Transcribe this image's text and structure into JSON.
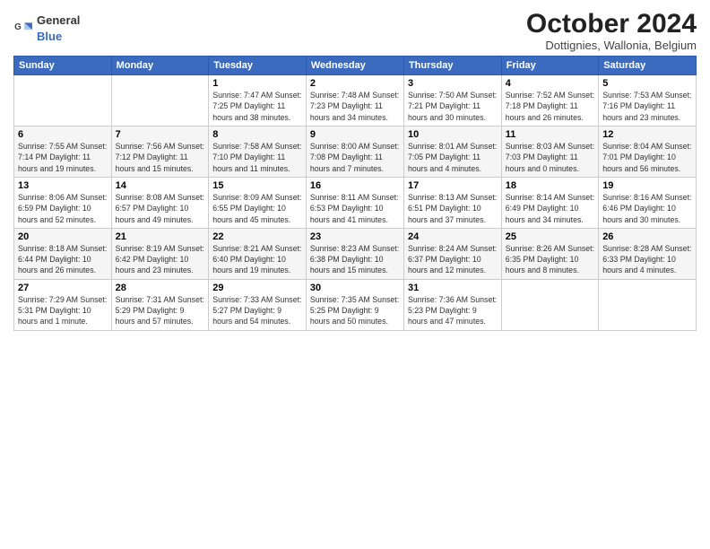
{
  "header": {
    "logo_general": "General",
    "logo_blue": "Blue",
    "month_title": "October 2024",
    "location": "Dottignies, Wallonia, Belgium"
  },
  "days_of_week": [
    "Sunday",
    "Monday",
    "Tuesday",
    "Wednesday",
    "Thursday",
    "Friday",
    "Saturday"
  ],
  "weeks": [
    [
      {
        "day": "",
        "info": ""
      },
      {
        "day": "",
        "info": ""
      },
      {
        "day": "1",
        "info": "Sunrise: 7:47 AM\nSunset: 7:25 PM\nDaylight: 11 hours and 38 minutes."
      },
      {
        "day": "2",
        "info": "Sunrise: 7:48 AM\nSunset: 7:23 PM\nDaylight: 11 hours and 34 minutes."
      },
      {
        "day": "3",
        "info": "Sunrise: 7:50 AM\nSunset: 7:21 PM\nDaylight: 11 hours and 30 minutes."
      },
      {
        "day": "4",
        "info": "Sunrise: 7:52 AM\nSunset: 7:18 PM\nDaylight: 11 hours and 26 minutes."
      },
      {
        "day": "5",
        "info": "Sunrise: 7:53 AM\nSunset: 7:16 PM\nDaylight: 11 hours and 23 minutes."
      }
    ],
    [
      {
        "day": "6",
        "info": "Sunrise: 7:55 AM\nSunset: 7:14 PM\nDaylight: 11 hours and 19 minutes."
      },
      {
        "day": "7",
        "info": "Sunrise: 7:56 AM\nSunset: 7:12 PM\nDaylight: 11 hours and 15 minutes."
      },
      {
        "day": "8",
        "info": "Sunrise: 7:58 AM\nSunset: 7:10 PM\nDaylight: 11 hours and 11 minutes."
      },
      {
        "day": "9",
        "info": "Sunrise: 8:00 AM\nSunset: 7:08 PM\nDaylight: 11 hours and 7 minutes."
      },
      {
        "day": "10",
        "info": "Sunrise: 8:01 AM\nSunset: 7:05 PM\nDaylight: 11 hours and 4 minutes."
      },
      {
        "day": "11",
        "info": "Sunrise: 8:03 AM\nSunset: 7:03 PM\nDaylight: 11 hours and 0 minutes."
      },
      {
        "day": "12",
        "info": "Sunrise: 8:04 AM\nSunset: 7:01 PM\nDaylight: 10 hours and 56 minutes."
      }
    ],
    [
      {
        "day": "13",
        "info": "Sunrise: 8:06 AM\nSunset: 6:59 PM\nDaylight: 10 hours and 52 minutes."
      },
      {
        "day": "14",
        "info": "Sunrise: 8:08 AM\nSunset: 6:57 PM\nDaylight: 10 hours and 49 minutes."
      },
      {
        "day": "15",
        "info": "Sunrise: 8:09 AM\nSunset: 6:55 PM\nDaylight: 10 hours and 45 minutes."
      },
      {
        "day": "16",
        "info": "Sunrise: 8:11 AM\nSunset: 6:53 PM\nDaylight: 10 hours and 41 minutes."
      },
      {
        "day": "17",
        "info": "Sunrise: 8:13 AM\nSunset: 6:51 PM\nDaylight: 10 hours and 37 minutes."
      },
      {
        "day": "18",
        "info": "Sunrise: 8:14 AM\nSunset: 6:49 PM\nDaylight: 10 hours and 34 minutes."
      },
      {
        "day": "19",
        "info": "Sunrise: 8:16 AM\nSunset: 6:46 PM\nDaylight: 10 hours and 30 minutes."
      }
    ],
    [
      {
        "day": "20",
        "info": "Sunrise: 8:18 AM\nSunset: 6:44 PM\nDaylight: 10 hours and 26 minutes."
      },
      {
        "day": "21",
        "info": "Sunrise: 8:19 AM\nSunset: 6:42 PM\nDaylight: 10 hours and 23 minutes."
      },
      {
        "day": "22",
        "info": "Sunrise: 8:21 AM\nSunset: 6:40 PM\nDaylight: 10 hours and 19 minutes."
      },
      {
        "day": "23",
        "info": "Sunrise: 8:23 AM\nSunset: 6:38 PM\nDaylight: 10 hours and 15 minutes."
      },
      {
        "day": "24",
        "info": "Sunrise: 8:24 AM\nSunset: 6:37 PM\nDaylight: 10 hours and 12 minutes."
      },
      {
        "day": "25",
        "info": "Sunrise: 8:26 AM\nSunset: 6:35 PM\nDaylight: 10 hours and 8 minutes."
      },
      {
        "day": "26",
        "info": "Sunrise: 8:28 AM\nSunset: 6:33 PM\nDaylight: 10 hours and 4 minutes."
      }
    ],
    [
      {
        "day": "27",
        "info": "Sunrise: 7:29 AM\nSunset: 5:31 PM\nDaylight: 10 hours and 1 minute."
      },
      {
        "day": "28",
        "info": "Sunrise: 7:31 AM\nSunset: 5:29 PM\nDaylight: 9 hours and 57 minutes."
      },
      {
        "day": "29",
        "info": "Sunrise: 7:33 AM\nSunset: 5:27 PM\nDaylight: 9 hours and 54 minutes."
      },
      {
        "day": "30",
        "info": "Sunrise: 7:35 AM\nSunset: 5:25 PM\nDaylight: 9 hours and 50 minutes."
      },
      {
        "day": "31",
        "info": "Sunrise: 7:36 AM\nSunset: 5:23 PM\nDaylight: 9 hours and 47 minutes."
      },
      {
        "day": "",
        "info": ""
      },
      {
        "day": "",
        "info": ""
      }
    ]
  ]
}
